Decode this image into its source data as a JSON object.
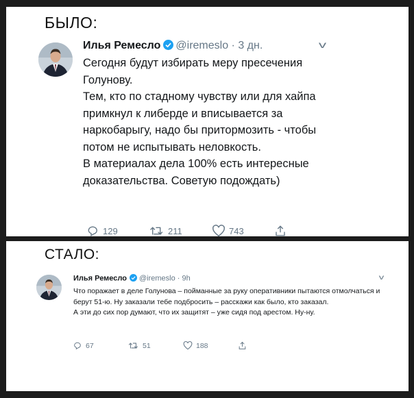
{
  "before": {
    "section_label": "БЫЛО:",
    "tweet": {
      "author_name": "Илья Ремесло",
      "handle": "@iremeslo",
      "separator": " · ",
      "time": "3 дн.",
      "lines": [
        "Сегодня будут избирать меру пресечения Голунову.",
        "Тем, кто по стадному чувству или для хайпа примкнул к либерде и вписывается за наркобарыгу, надо бы притормозить - чтобы потом не испытывать неловкость.",
        "В материалах дела 100% есть интересные доказательства. Советую подождать)"
      ],
      "replies": "129",
      "retweets": "211",
      "likes": "743"
    }
  },
  "after": {
    "section_label": "СТАЛО:",
    "tweet": {
      "author_name": "Илья Ремесло",
      "handle": "@iremeslo",
      "separator": " · ",
      "time": "9h",
      "lines": [
        "Что поражает в деле Голунова –  пойманные за руку оперативники пытаются отмолчаться и берут 51-ю. Ну заказали тебе подбросить – расскажи как было, кто заказал.",
        "А эти до сих пор думают, что их защитят – уже сидя под арестом. Ну-ну."
      ],
      "replies": "67",
      "retweets": "51",
      "likes": "188"
    }
  },
  "colors": {
    "background": "#1c1c1c",
    "panel": "#ffffff",
    "text": "#14171a",
    "meta": "#657786",
    "verified": "#1da1f2"
  },
  "icons": [
    "verified-badge-icon",
    "chevron-down-icon",
    "reply-icon",
    "retweet-icon",
    "like-icon",
    "share-icon"
  ]
}
